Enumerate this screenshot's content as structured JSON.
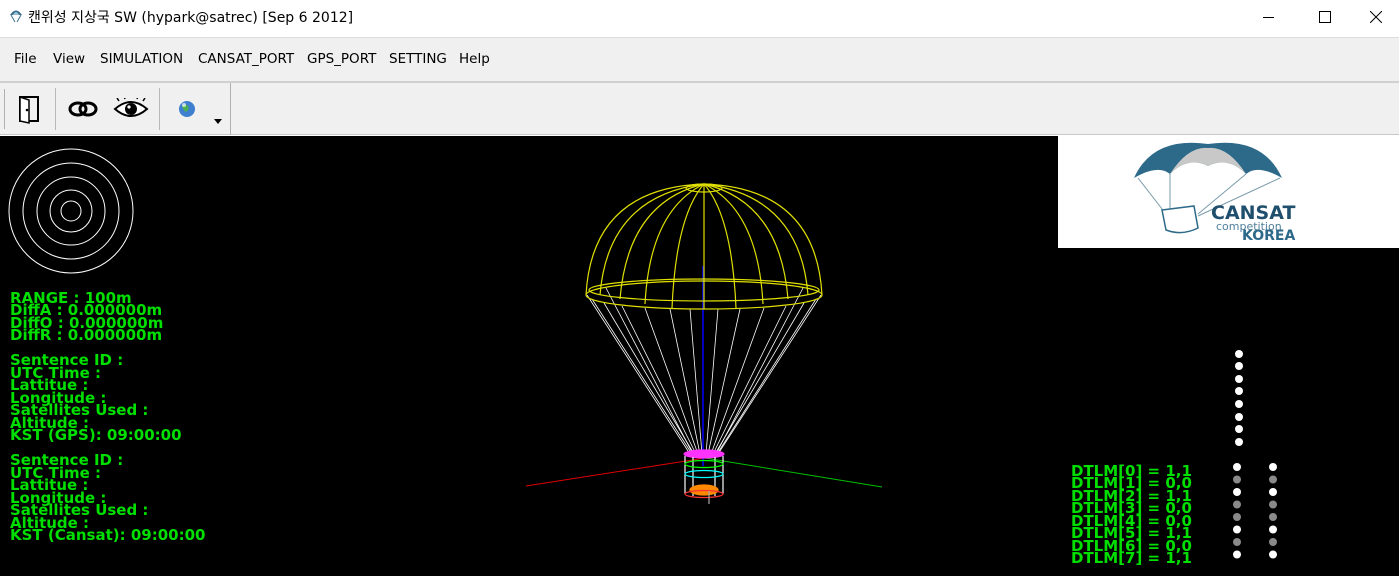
{
  "window": {
    "title": "캔위성 지상국 SW (hypark@satrec) [Sep  6 2012]"
  },
  "menu": {
    "file": "File",
    "view": "View",
    "simulation": "SIMULATION",
    "cansat_port": "CANSAT_PORT",
    "gps_port": "GPS_PORT",
    "setting": "SETTING",
    "help": "Help"
  },
  "toolbar": {
    "icons": [
      "exit-door-icon",
      "link-icon",
      "eye-icon",
      "globe-icon",
      "dropdown-arrow-icon"
    ]
  },
  "range_info": {
    "range": "RANGE : 100m",
    "diff_a": "DiffA : 0.000000m",
    "diff_o": "DiffO : 0.000000m",
    "diff_r": "DiffR : 0.000000m"
  },
  "gps_block": {
    "sentence_id": "Sentence ID :",
    "utc_time": "UTC Time :",
    "lattitue": "Lattitue :",
    "longitude": "Longitude :",
    "satellites": "Satellites Used :",
    "altitude": "Altitude :",
    "kst": "KST (GPS): 09:00:00"
  },
  "cansat_block": {
    "sentence_id": "Sentence ID :",
    "utc_time": "UTC Time :",
    "lattitue": "Lattitue :",
    "longitude": "Longitude :",
    "satellites": "Satellites Used :",
    "altitude": "Altitude :",
    "kst": "KST (Cansat): 09:00:00"
  },
  "dtlm": [
    "DTLM[0] = 1,1",
    "DTLM[1] = 0,0",
    "DTLM[2] = 1,1",
    "DTLM[3] = 0,0",
    "DTLM[4] = 0,0",
    "DTLM[5] = 1,1",
    "DTLM[6] = 0,0",
    "DTLM[7] = 1,1"
  ],
  "dtlm_bits": [
    [
      1,
      1
    ],
    [
      0,
      0
    ],
    [
      1,
      1
    ],
    [
      0,
      0
    ],
    [
      0,
      0
    ],
    [
      1,
      1
    ],
    [
      0,
      0
    ],
    [
      1,
      1
    ]
  ],
  "logo": {
    "title": "CANSAT",
    "sub": "competition",
    "country": "KOREA"
  },
  "colors": {
    "text_green": "#00e000",
    "parachute": "#e0e000",
    "lines": "#ffffff",
    "logo_blue": "#2d6a8a"
  }
}
